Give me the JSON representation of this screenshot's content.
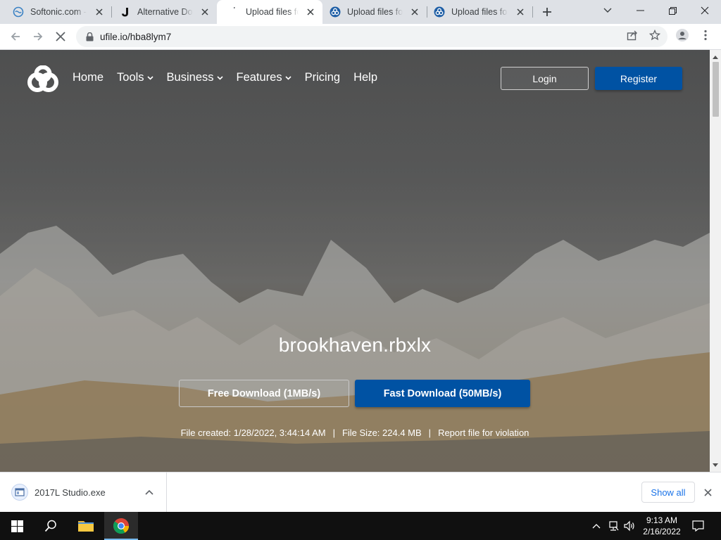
{
  "browser": {
    "tabs": [
      {
        "title": "Softonic.com - F",
        "icon": "softonic-favicon"
      },
      {
        "title": "Alternative Dow",
        "icon": "j-favicon"
      },
      {
        "title": "Upload files for",
        "icon": "loading-spinner-icon",
        "active": true
      },
      {
        "title": "Upload files for",
        "icon": "ufile-favicon"
      },
      {
        "title": "Upload files for",
        "icon": "ufile-favicon"
      }
    ],
    "url": "ufile.io/hba8lym7"
  },
  "site": {
    "nav": {
      "items": [
        {
          "label": "Home",
          "dropdown": false
        },
        {
          "label": "Tools",
          "dropdown": true
        },
        {
          "label": "Business",
          "dropdown": true
        },
        {
          "label": "Features",
          "dropdown": true
        },
        {
          "label": "Pricing",
          "dropdown": false
        },
        {
          "label": "Help",
          "dropdown": false
        }
      ],
      "login_label": "Login",
      "register_label": "Register"
    },
    "file": {
      "name": "brookhaven.rbxlx",
      "free_download_label": "Free Download (1MB/s)",
      "fast_download_label": "Fast Download (50MB/s)",
      "created": "File created: 1/28/2022, 3:44:14 AM",
      "size": "File Size: 224.4 MB",
      "separator": "|",
      "report_label": "Report file for violation"
    },
    "colors": {
      "accent": "#0052a3"
    }
  },
  "download_shelf": {
    "item_name": "2017L Studio.exe",
    "show_all_label": "Show all"
  },
  "taskbar": {
    "time": "9:13 AM",
    "date": "2/16/2022"
  }
}
